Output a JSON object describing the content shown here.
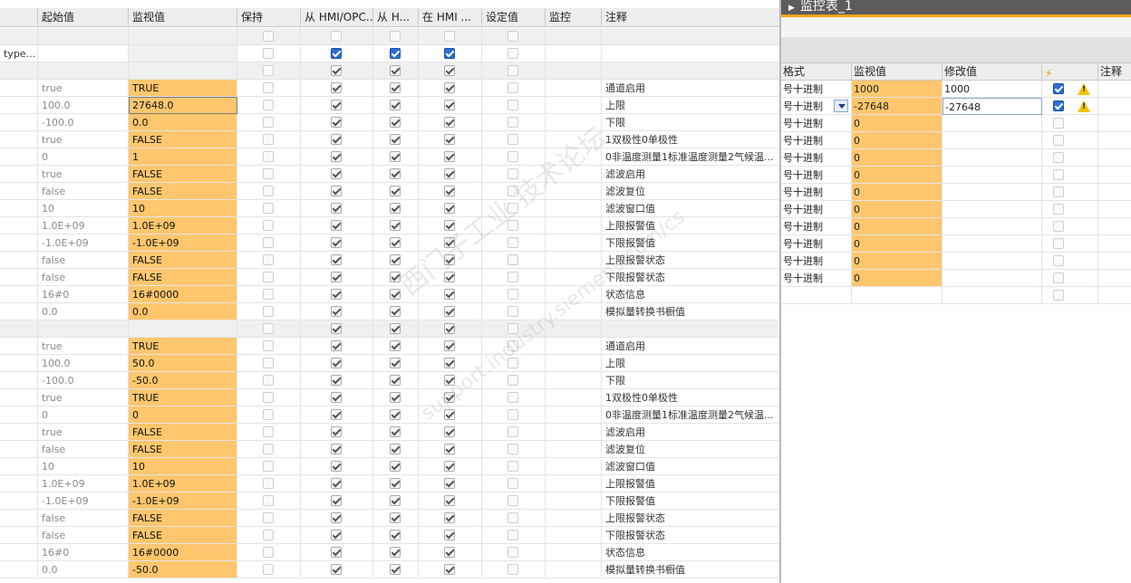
{
  "left_table": {
    "headers": {
      "start": "起始值",
      "monitor": "监视值",
      "retain": "保持",
      "from_hmi_opc": "从 HMI/OPC...",
      "from_h": "从 H...",
      "in_hmi": "在 HMI ...",
      "setpoint": "设定值",
      "monitoring": "监控",
      "comment": "注释"
    },
    "rows": [
      {
        "name": "",
        "start": "",
        "monitor": "",
        "note": "",
        "mon_style": "grey",
        "checks": [
          0,
          0,
          0,
          0,
          0
        ],
        "shade": true
      },
      {
        "name": "type...",
        "start": "",
        "monitor": "",
        "note": "",
        "mon_style": "grey",
        "checks": [
          0,
          2,
          2,
          2,
          0
        ],
        "shade": false
      },
      {
        "name": "",
        "start": "",
        "monitor": "",
        "note": "",
        "mon_style": "grey",
        "checks": [
          0,
          1,
          1,
          1,
          0
        ],
        "shade": true
      },
      {
        "name": "",
        "start": "true",
        "monitor": "TRUE",
        "note": "通道启用",
        "mon_style": "orange",
        "checks": [
          0,
          1,
          1,
          1,
          0
        ]
      },
      {
        "name": "",
        "start": "100.0",
        "monitor": "27648.0",
        "note": "上限",
        "mon_style": "sel",
        "checks": [
          0,
          1,
          1,
          1,
          0
        ]
      },
      {
        "name": "",
        "start": "-100.0",
        "monitor": "0.0",
        "note": "下限",
        "mon_style": "orange",
        "checks": [
          0,
          1,
          1,
          1,
          0
        ]
      },
      {
        "name": "",
        "start": "true",
        "monitor": "FALSE",
        "note": "1双极性0单极性",
        "mon_style": "orange",
        "checks": [
          0,
          1,
          1,
          1,
          0
        ]
      },
      {
        "name": "",
        "start": "0",
        "monitor": "1",
        "note": "0非温度测量1标准温度测量2气候温...",
        "mon_style": "orange",
        "checks": [
          0,
          1,
          1,
          1,
          0
        ]
      },
      {
        "name": "",
        "start": "true",
        "monitor": "FALSE",
        "note": "滤波启用",
        "mon_style": "orange",
        "checks": [
          0,
          1,
          1,
          1,
          0
        ]
      },
      {
        "name": "",
        "start": "false",
        "monitor": "FALSE",
        "note": "滤波复位",
        "mon_style": "orange",
        "checks": [
          0,
          1,
          1,
          1,
          0
        ]
      },
      {
        "name": "",
        "start": "10",
        "monitor": "10",
        "note": "滤波窗口值",
        "mon_style": "orange",
        "checks": [
          0,
          1,
          1,
          1,
          0
        ]
      },
      {
        "name": "",
        "start": "1.0E+09",
        "monitor": "1.0E+09",
        "note": "上限报警值",
        "mon_style": "orange",
        "checks": [
          0,
          1,
          1,
          1,
          0
        ]
      },
      {
        "name": "",
        "start": "-1.0E+09",
        "monitor": "-1.0E+09",
        "note": "下限报警值",
        "mon_style": "orange",
        "checks": [
          0,
          1,
          1,
          1,
          0
        ]
      },
      {
        "name": "",
        "start": "false",
        "monitor": "FALSE",
        "note": "上限报警状态",
        "mon_style": "orange",
        "checks": [
          0,
          1,
          1,
          1,
          0
        ]
      },
      {
        "name": "",
        "start": "false",
        "monitor": "FALSE",
        "note": "下限报警状态",
        "mon_style": "orange",
        "checks": [
          0,
          1,
          1,
          1,
          0
        ]
      },
      {
        "name": "",
        "start": "16#0",
        "monitor": "16#0000",
        "note": "状态信息",
        "mon_style": "orange",
        "checks": [
          0,
          1,
          1,
          1,
          0
        ]
      },
      {
        "name": "",
        "start": "0.0",
        "monitor": "0.0",
        "note": "模拟量转换书橱值",
        "mon_style": "orange",
        "checks": [
          0,
          1,
          1,
          1,
          0
        ]
      },
      {
        "name": "",
        "start": "",
        "monitor": "",
        "note": "",
        "mon_style": "grey",
        "checks": [
          0,
          1,
          1,
          1,
          0
        ],
        "shade": true
      },
      {
        "name": "",
        "start": "true",
        "monitor": "TRUE",
        "note": "通道启用",
        "mon_style": "orange",
        "checks": [
          0,
          1,
          1,
          1,
          0
        ]
      },
      {
        "name": "",
        "start": "100.0",
        "monitor": "50.0",
        "note": "上限",
        "mon_style": "orange",
        "checks": [
          0,
          1,
          1,
          1,
          0
        ]
      },
      {
        "name": "",
        "start": "-100.0",
        "monitor": "-50.0",
        "note": "下限",
        "mon_style": "orange",
        "checks": [
          0,
          1,
          1,
          1,
          0
        ]
      },
      {
        "name": "",
        "start": "true",
        "monitor": "TRUE",
        "note": "1双极性0单极性",
        "mon_style": "orange",
        "checks": [
          0,
          1,
          1,
          1,
          0
        ]
      },
      {
        "name": "",
        "start": "0",
        "monitor": "0",
        "note": "0非温度测量1标准温度测量2气候温...",
        "mon_style": "orange",
        "checks": [
          0,
          1,
          1,
          1,
          0
        ]
      },
      {
        "name": "",
        "start": "true",
        "monitor": "FALSE",
        "note": "滤波启用",
        "mon_style": "orange",
        "checks": [
          0,
          1,
          1,
          1,
          0
        ]
      },
      {
        "name": "",
        "start": "false",
        "monitor": "FALSE",
        "note": "滤波复位",
        "mon_style": "orange",
        "checks": [
          0,
          1,
          1,
          1,
          0
        ]
      },
      {
        "name": "",
        "start": "10",
        "monitor": "10",
        "note": "滤波窗口值",
        "mon_style": "orange",
        "checks": [
          0,
          1,
          1,
          1,
          0
        ]
      },
      {
        "name": "",
        "start": "1.0E+09",
        "monitor": "1.0E+09",
        "note": "上限报警值",
        "mon_style": "orange",
        "checks": [
          0,
          1,
          1,
          1,
          0
        ]
      },
      {
        "name": "",
        "start": "-1.0E+09",
        "monitor": "-1.0E+09",
        "note": "下限报警值",
        "mon_style": "orange",
        "checks": [
          0,
          1,
          1,
          1,
          0
        ]
      },
      {
        "name": "",
        "start": "false",
        "monitor": "FALSE",
        "note": "上限报警状态",
        "mon_style": "orange",
        "checks": [
          0,
          1,
          1,
          1,
          0
        ]
      },
      {
        "name": "",
        "start": "false",
        "monitor": "FALSE",
        "note": "下限报警状态",
        "mon_style": "orange",
        "checks": [
          0,
          1,
          1,
          1,
          0
        ]
      },
      {
        "name": "",
        "start": "16#0",
        "monitor": "16#0000",
        "note": "状态信息",
        "mon_style": "orange",
        "checks": [
          0,
          1,
          1,
          1,
          0
        ]
      },
      {
        "name": "",
        "start": "0.0",
        "monitor": "-50.0",
        "note": "模拟量转换书橱值",
        "mon_style": "orange",
        "checks": [
          0,
          1,
          1,
          1,
          0
        ]
      }
    ]
  },
  "watch_table": {
    "title": "监控表_1",
    "headers": {
      "format": "格式",
      "monitor": "监视值",
      "modify": "修改值",
      "comment": "注释"
    },
    "rows": [
      {
        "format": "号十进制",
        "monitor": "1000",
        "modify": "1000",
        "checked": true,
        "warn": true,
        "dropdown": false
      },
      {
        "format": "号十进制",
        "monitor": "-27648",
        "modify": "-27648",
        "checked": true,
        "warn": true,
        "dropdown": true
      },
      {
        "format": "号十进制",
        "monitor": "0",
        "modify": "",
        "checked": false,
        "warn": false,
        "dropdown": false
      },
      {
        "format": "号十进制",
        "monitor": "0",
        "modify": "",
        "checked": false,
        "warn": false,
        "dropdown": false
      },
      {
        "format": "号十进制",
        "monitor": "0",
        "modify": "",
        "checked": false,
        "warn": false,
        "dropdown": false
      },
      {
        "format": "号十进制",
        "monitor": "0",
        "modify": "",
        "checked": false,
        "warn": false,
        "dropdown": false
      },
      {
        "format": "号十进制",
        "monitor": "0",
        "modify": "",
        "checked": false,
        "warn": false,
        "dropdown": false
      },
      {
        "format": "号十进制",
        "monitor": "0",
        "modify": "",
        "checked": false,
        "warn": false,
        "dropdown": false
      },
      {
        "format": "号十进制",
        "monitor": "0",
        "modify": "",
        "checked": false,
        "warn": false,
        "dropdown": false
      },
      {
        "format": "号十进制",
        "monitor": "0",
        "modify": "",
        "checked": false,
        "warn": false,
        "dropdown": false
      },
      {
        "format": "号十进制",
        "monitor": "0",
        "modify": "",
        "checked": false,
        "warn": false,
        "dropdown": false
      },
      {
        "format": "号十进制",
        "monitor": "0",
        "modify": "",
        "checked": false,
        "warn": false,
        "dropdown": false
      },
      {
        "format": "",
        "monitor": "",
        "modify": "",
        "checked": false,
        "warn": false,
        "dropdown": false,
        "empty": true
      }
    ]
  },
  "watermark": {
    "line1": "西门子工业  技术论坛",
    "line2": "support.industry.siemens.com/cs"
  },
  "colors": {
    "monitor_orange": "#ffc66d",
    "title_bar": "#5c5c5c",
    "accent_orange": "#f5a21b",
    "check_blue": "#2b6fd6"
  }
}
